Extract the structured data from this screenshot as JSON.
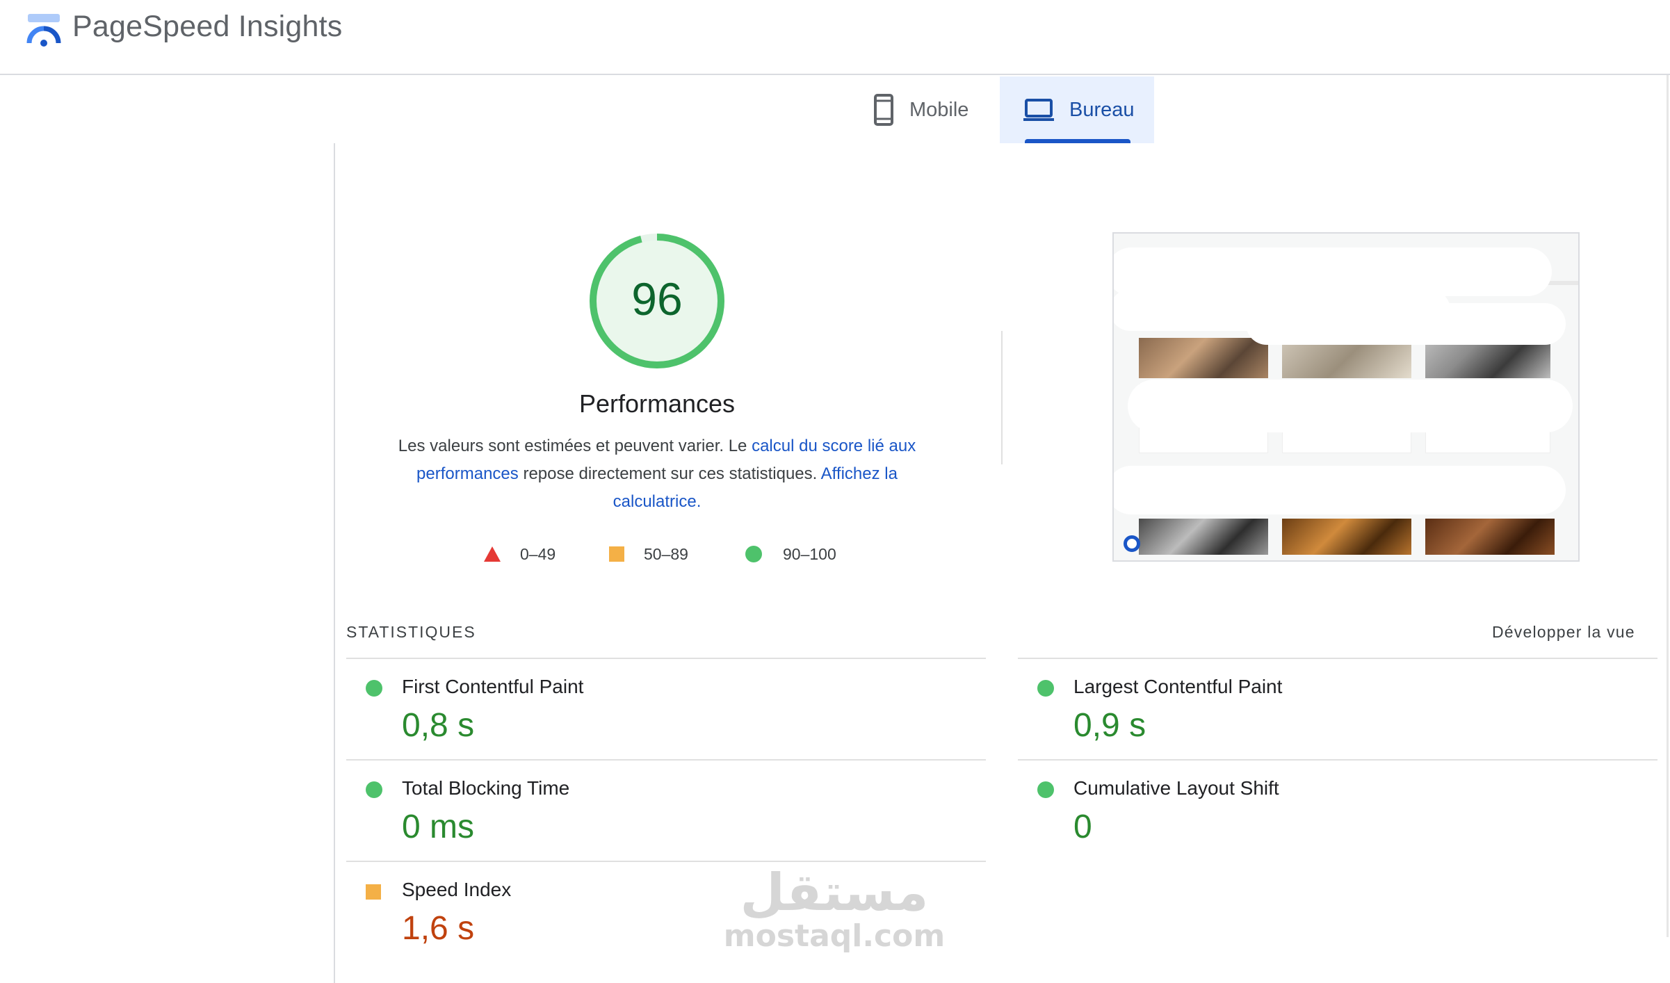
{
  "header": {
    "app_title": "PageSpeed Insights",
    "logo_icon": "pagespeed-gauge-icon"
  },
  "tabs": [
    {
      "label": "Mobile",
      "icon": "smartphone-icon",
      "selected": false
    },
    {
      "label": "Bureau",
      "icon": "laptop-icon",
      "selected": true
    }
  ],
  "performance": {
    "score": "96",
    "title": "Performances",
    "desc_part1": "Les valeurs sont estimées et peuvent varier. Le ",
    "link1": "calcul du score lié aux performances",
    "desc_part2": " repose directement sur ces statistiques. ",
    "link2": "Affichez la calculatrice.",
    "legend": [
      {
        "range": "0–49",
        "shape": "triangle",
        "color": "#e53935"
      },
      {
        "range": "50–89",
        "shape": "square",
        "color": "#f4b046"
      },
      {
        "range": "90–100",
        "shape": "circle",
        "color": "#4ec26b"
      }
    ]
  },
  "stats": {
    "title": "STATISTIQUES",
    "expand_label": "Développer la vue",
    "metrics": [
      {
        "name": "First Contentful Paint",
        "value": "0,8 s",
        "rating": "pass"
      },
      {
        "name": "Largest Contentful Paint",
        "value": "0,9 s",
        "rating": "pass"
      },
      {
        "name": "Total Blocking Time",
        "value": "0 ms",
        "rating": "pass"
      },
      {
        "name": "Cumulative Layout Shift",
        "value": "0",
        "rating": "pass"
      },
      {
        "name": "Speed Index",
        "value": "1,6 s",
        "rating": "average"
      }
    ]
  },
  "colors": {
    "pass": "#4ec26b",
    "average": "#f4b046",
    "fail": "#e53935",
    "accent": "#1a56c7"
  },
  "watermark": {
    "arabic": "مستقل",
    "latin": "mostaql.com"
  }
}
